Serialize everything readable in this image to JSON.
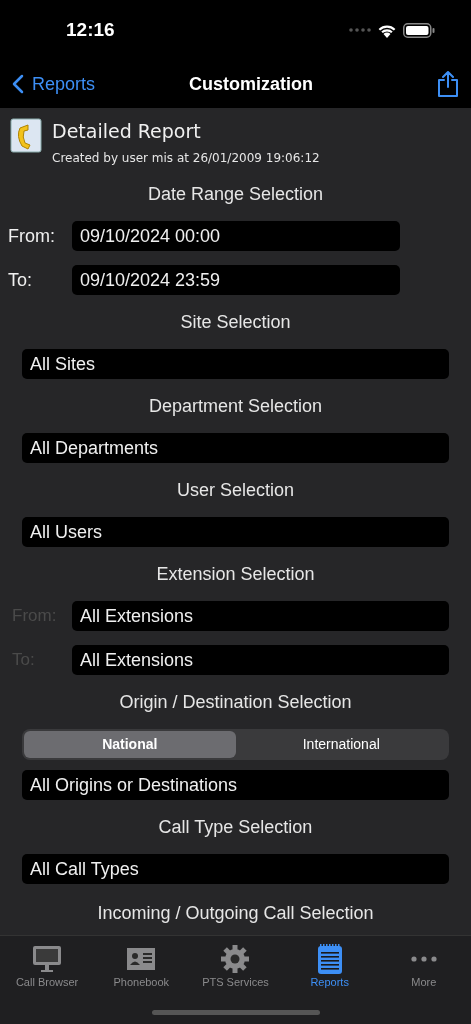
{
  "status_bar": {
    "time": "12:16"
  },
  "nav": {
    "back": "Reports",
    "title": "Customization"
  },
  "report": {
    "title": "Detailed Report",
    "subtitle": "Created by user mis at 26/01/2009 19:06:12"
  },
  "sections": [
    {
      "kind": "date_range",
      "heading": "Date Range Selection",
      "rows": [
        {
          "label": "From:",
          "value": "09/10/2024 00:00"
        },
        {
          "label": "To:",
          "value": "09/10/2024 23:59"
        }
      ]
    },
    {
      "kind": "field",
      "heading": "Site Selection",
      "value": "All Sites"
    },
    {
      "kind": "field",
      "heading": "Department Selection",
      "value": "All Departments"
    },
    {
      "kind": "field",
      "heading": "User Selection",
      "value": "All Users"
    },
    {
      "kind": "extension_range",
      "heading": "Extension Selection",
      "rows": [
        {
          "label": "From:",
          "value": "All Extensions"
        },
        {
          "label": "To:",
          "value": "All Extensions"
        }
      ]
    },
    {
      "kind": "segmented",
      "heading": "Origin / Destination Selection",
      "options": [
        {
          "label": "National",
          "selected": true
        },
        {
          "label": "International",
          "selected": false
        }
      ],
      "value": "All Origins or Destinations"
    },
    {
      "kind": "field",
      "heading": "Call Type Selection",
      "value": "All Call Types"
    },
    {
      "kind": "heading",
      "heading": "Incoming / Outgoing Call Selection"
    }
  ],
  "tabs": [
    {
      "label": "Call Browser",
      "kind": "monitor",
      "selected": false
    },
    {
      "label": "Phonebook",
      "kind": "card",
      "selected": false
    },
    {
      "label": "PTS Services",
      "kind": "gear",
      "selected": false
    },
    {
      "label": "Reports",
      "kind": "notepad",
      "selected": true
    },
    {
      "label": "More",
      "kind": "dots",
      "selected": false
    }
  ]
}
